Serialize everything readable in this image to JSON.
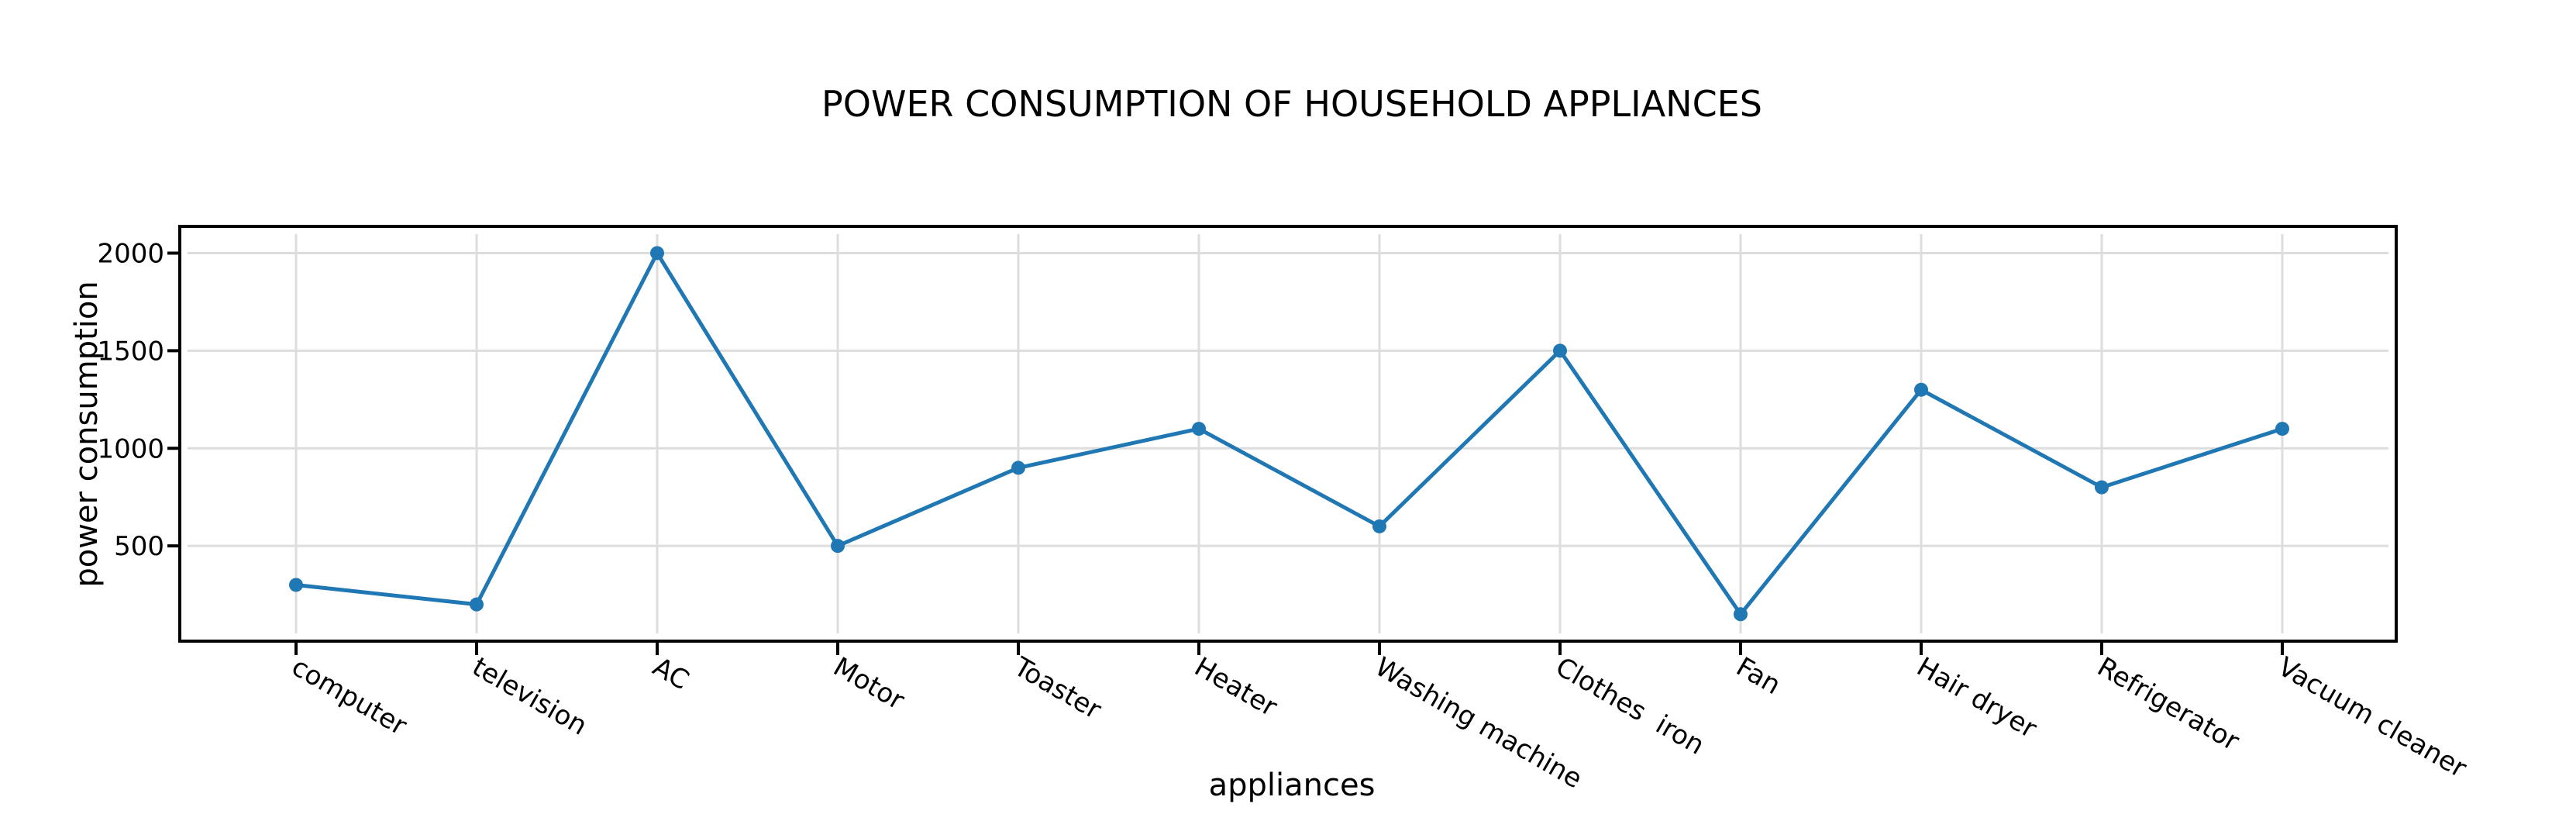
{
  "chart_data": {
    "type": "line",
    "title": "POWER CONSUMPTION OF HOUSEHOLD APPLIANCES",
    "xlabel": "appliances",
    "ylabel": "power consumption",
    "categories": [
      "computer",
      "television",
      "AC",
      "Motor",
      "Toaster",
      "Heater",
      "Washing machine",
      "Clothes  iron",
      "Fan",
      "Hair dryer",
      "Refrigerator",
      "Vacuum cleaner"
    ],
    "series": [
      {
        "name": "power consumption",
        "values": [
          300,
          200,
          2000,
          500,
          900,
          1100,
          600,
          1500,
          150,
          1300,
          800,
          1100
        ],
        "color": "#1f77b4",
        "mode": "lines+markers"
      }
    ],
    "ylim": [
      12,
      2137
    ],
    "yticks": [
      500,
      1000,
      1500,
      2000
    ],
    "ytick_labels": [
      "500",
      "1000",
      "1500",
      "2000"
    ],
    "grid": true,
    "legend": "none"
  }
}
